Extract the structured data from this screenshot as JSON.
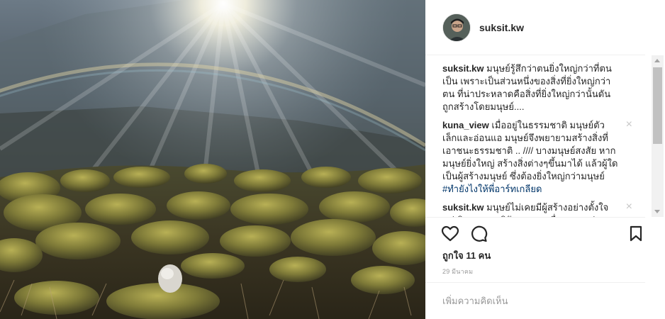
{
  "post": {
    "username": "suksit.kw",
    "likes_text": "ถูกใจ 11 คน",
    "date_text": "29 มีนาคม"
  },
  "comments": [
    {
      "user": "suksit.kw",
      "text": " มนุษย์รู้สึกว่าตนยิ่งใหญ่กว่าที่ตนเป็น เพราะเป็นส่วนหนึ่งของสิ่งที่ยิ่งใหญ่กว่าตน ที่น่าประหลาดคือสิ่งที่ยิ่งใหญ่กว่านั้นดันถูกสร้างโดยมนุษย์....",
      "tag": "",
      "after_tag": ""
    },
    {
      "user": "kuna_view",
      "text": " เมื่ออยู่ในธรรมชาติ มนุษย์ตัวเล็กและอ่อนแอ มนุษย์จึงพยายามสร้างสิ่งที่เอาชนะธรรมชาติ .. //// บางมนุษย์สงสัย หากมนุษย์ยิ่งใหญ่ สร้างสิ่งต่างๆขึ้นมาได้ แล้วผู้ใดเป็นผู้สร้างมนุษย์ ซึ่งต้องยิ่งใหญ่กว่ามนุษย์ ",
      "tag": "#ทำยังไงให้พี่อาร์ทเกลียด",
      "after_tag": "",
      "close_icon": "×"
    },
    {
      "user": "suksit.kw",
      "text": " มนุษย์ไม่เคยมีผู้สร้างอย่างตั้งใจ แต่เกิดจากการวิวัฒนาการเพื่อความอยู่รอด",
      "tag": "",
      "after_tag": "",
      "close_icon": "×"
    }
  ],
  "add_comment": {
    "placeholder": "เพิ่มความคิดเห็น"
  },
  "icons": {
    "like": "heart-outline-icon",
    "comment": "speech-bubble-icon",
    "save": "bookmark-icon",
    "delete": "close-icon"
  },
  "colors": {
    "text": "#262626",
    "muted": "#999999",
    "hashtag": "#003569",
    "divider": "#efefef"
  }
}
